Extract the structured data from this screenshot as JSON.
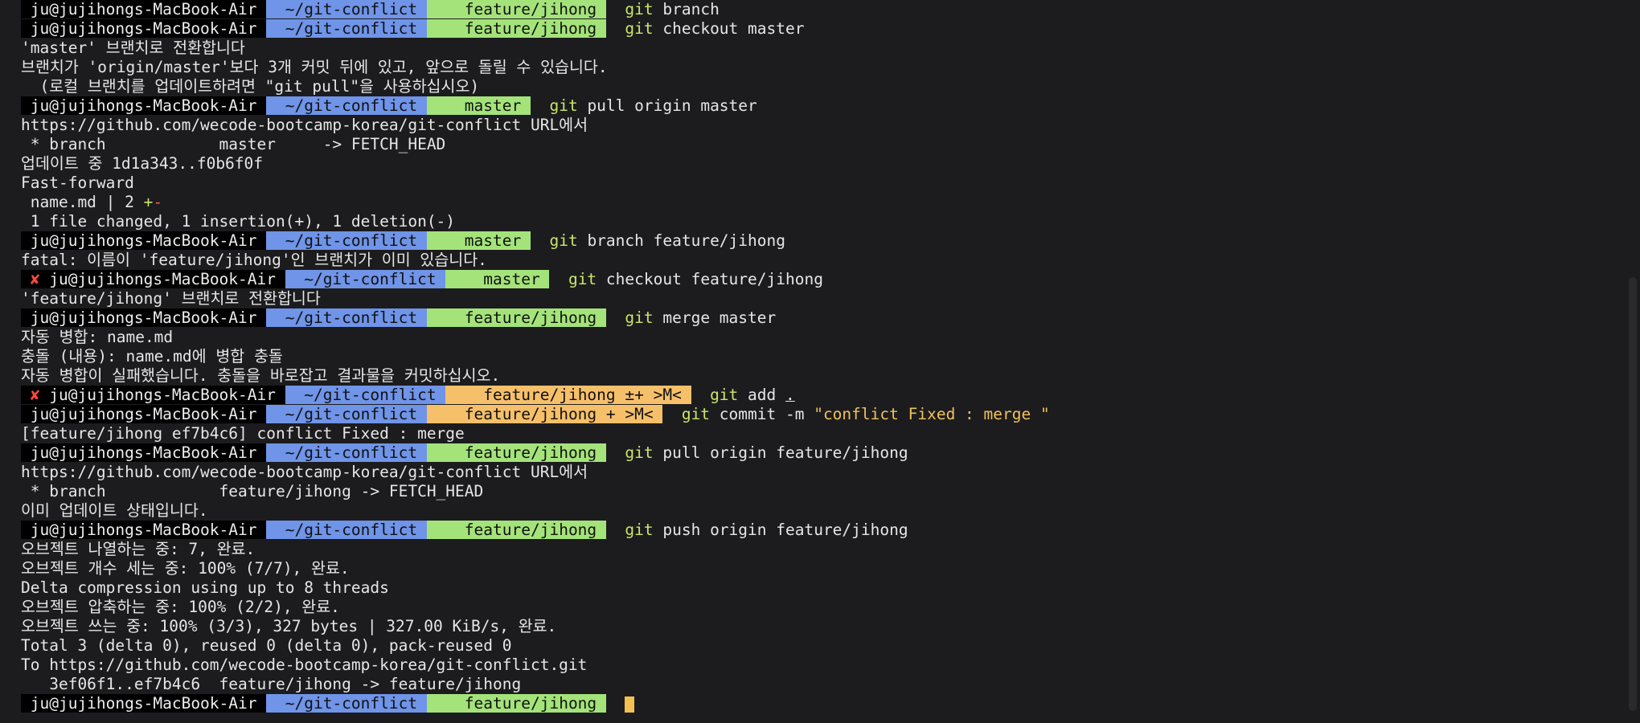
{
  "terminal": {
    "lines": [
      [
        {
          "t": " ju@jujihongs-MacBook-Air ",
          "c": "user"
        },
        {
          "t": "  ~/git-conflict ",
          "c": "dir"
        },
        {
          "t": "    feature/jihong ",
          "c": "clean"
        },
        {
          "t": "  "
        },
        {
          "t": "git",
          "c": "cmd"
        },
        {
          "t": " branch"
        }
      ],
      [
        {
          "t": " ju@jujihongs-MacBook-Air ",
          "c": "user"
        },
        {
          "t": "  ~/git-conflict ",
          "c": "dir"
        },
        {
          "t": "    feature/jihong ",
          "c": "clean"
        },
        {
          "t": "  "
        },
        {
          "t": "git",
          "c": "cmd"
        },
        {
          "t": " checkout master"
        }
      ],
      [
        {
          "t": "'master' 브랜치로 전환합니다"
        }
      ],
      [
        {
          "t": "브랜치가 'origin/master'보다 3개 커밋 뒤에 있고, 앞으로 돌릴 수 있습니다."
        }
      ],
      [
        {
          "t": "  (로컬 브랜치를 업데이트하려면 \"git pull\"을 사용하십시오)"
        }
      ],
      [
        {
          "t": " ju@jujihongs-MacBook-Air ",
          "c": "user"
        },
        {
          "t": "  ~/git-conflict ",
          "c": "dir"
        },
        {
          "t": "    master ",
          "c": "clean"
        },
        {
          "t": "  "
        },
        {
          "t": "git",
          "c": "cmd"
        },
        {
          "t": " pull origin master"
        }
      ],
      [
        {
          "t": "https://github.com/wecode-bootcamp-korea/git-conflict URL에서"
        }
      ],
      [
        {
          "t": " * branch            master     -> FETCH_HEAD"
        }
      ],
      [
        {
          "t": "업데이트 중 1d1a343..f0b6f0f"
        }
      ],
      [
        {
          "t": "Fast-forward"
        }
      ],
      [
        {
          "t": " name.md | 2 "
        },
        {
          "t": "+",
          "c": "add"
        },
        {
          "t": "-",
          "c": "del"
        }
      ],
      [
        {
          "t": " 1 file changed, 1 insertion(+), 1 deletion(-)"
        }
      ],
      [
        {
          "t": " ju@jujihongs-MacBook-Air ",
          "c": "user"
        },
        {
          "t": "  ~/git-conflict ",
          "c": "dir"
        },
        {
          "t": "    master ",
          "c": "clean"
        },
        {
          "t": "  "
        },
        {
          "t": "git",
          "c": "cmd"
        },
        {
          "t": " branch feature/jihong"
        }
      ],
      [
        {
          "t": "fatal: 이름이 'feature/jihong'인 브랜치가 이미 있습니다."
        }
      ],
      [
        {
          "t": " ✘ ",
          "c": "err"
        },
        {
          "t": "ju@jujihongs-MacBook-Air ",
          "c": "user"
        },
        {
          "t": "  ~/git-conflict ",
          "c": "dir"
        },
        {
          "t": "    master ",
          "c": "clean"
        },
        {
          "t": "  "
        },
        {
          "t": "git",
          "c": "cmd"
        },
        {
          "t": " checkout feature/jihong"
        }
      ],
      [
        {
          "t": "'feature/jihong' 브랜치로 전환합니다"
        }
      ],
      [
        {
          "t": " ju@jujihongs-MacBook-Air ",
          "c": "user"
        },
        {
          "t": "  ~/git-conflict ",
          "c": "dir"
        },
        {
          "t": "    feature/jihong ",
          "c": "clean"
        },
        {
          "t": "  "
        },
        {
          "t": "git",
          "c": "cmd"
        },
        {
          "t": " merge master"
        }
      ],
      [
        {
          "t": "자동 병합: name.md"
        }
      ],
      [
        {
          "t": "충돌 (내용): name.md에 병합 충돌"
        }
      ],
      [
        {
          "t": "자동 병합이 실패했습니다. 충돌을 바로잡고 결과물을 커밋하십시오."
        }
      ],
      [
        {
          "t": " ✘ ",
          "c": "err"
        },
        {
          "t": "ju@jujihongs-MacBook-Air ",
          "c": "user"
        },
        {
          "t": "  ~/git-conflict ",
          "c": "dir"
        },
        {
          "t": "    feature/jihong ±+ >M< ",
          "c": "dirty"
        },
        {
          "t": "  "
        },
        {
          "t": "git",
          "c": "cmd"
        },
        {
          "t": " add "
        },
        {
          "t": ".",
          "c": "under"
        }
      ],
      [
        {
          "t": " ju@jujihongs-MacBook-Air ",
          "c": "user"
        },
        {
          "t": "  ~/git-conflict ",
          "c": "dir"
        },
        {
          "t": "    feature/jihong + >M< ",
          "c": "dirty"
        },
        {
          "t": "  "
        },
        {
          "t": "git",
          "c": "cmd"
        },
        {
          "t": " commit -m "
        },
        {
          "t": "\"conflict Fixed : merge \"",
          "c": "str"
        }
      ],
      [
        {
          "t": "[feature/jihong ef7b4c6] conflict Fixed : merge"
        }
      ],
      [
        {
          "t": " ju@jujihongs-MacBook-Air ",
          "c": "user"
        },
        {
          "t": "  ~/git-conflict ",
          "c": "dir"
        },
        {
          "t": "    feature/jihong ",
          "c": "clean"
        },
        {
          "t": "  "
        },
        {
          "t": "git",
          "c": "cmd"
        },
        {
          "t": " pull origin feature/jihong"
        }
      ],
      [
        {
          "t": "https://github.com/wecode-bootcamp-korea/git-conflict URL에서"
        }
      ],
      [
        {
          "t": " * branch            feature/jihong -> FETCH_HEAD"
        }
      ],
      [
        {
          "t": "이미 업데이트 상태입니다."
        }
      ],
      [
        {
          "t": " ju@jujihongs-MacBook-Air ",
          "c": "user"
        },
        {
          "t": "  ~/git-conflict ",
          "c": "dir"
        },
        {
          "t": "    feature/jihong ",
          "c": "clean"
        },
        {
          "t": "  "
        },
        {
          "t": "git",
          "c": "cmd"
        },
        {
          "t": " push origin feature/jihong"
        }
      ],
      [
        {
          "t": "오브젝트 나열하는 중: 7, 완료."
        }
      ],
      [
        {
          "t": "오브젝트 개수 세는 중: 100% (7/7), 완료."
        }
      ],
      [
        {
          "t": "Delta compression using up to 8 threads"
        }
      ],
      [
        {
          "t": "오브젝트 압축하는 중: 100% (2/2), 완료."
        }
      ],
      [
        {
          "t": "오브젝트 쓰는 중: 100% (3/3), 327 bytes | 327.00 KiB/s, 완료."
        }
      ],
      [
        {
          "t": "Total 3 (delta 0), reused 0 (delta 0), pack-reused 0"
        }
      ],
      [
        {
          "t": "To https://github.com/wecode-bootcamp-korea/git-conflict.git"
        }
      ],
      [
        {
          "t": "   3ef06f1..ef7b4c6  feature/jihong -> feature/jihong"
        }
      ],
      [
        {
          "t": " ju@jujihongs-MacBook-Air ",
          "c": "user"
        },
        {
          "t": "  ~/git-conflict ",
          "c": "dir"
        },
        {
          "t": "    feature/jihong ",
          "c": "clean"
        },
        {
          "t": "  "
        }
      ]
    ]
  },
  "colors": {
    "background": "#1c1c1e",
    "dir_segment": "#6f94e8",
    "clean_branch_segment": "#a4e37a",
    "dirty_branch_segment": "#f6c06a",
    "command": "#c9e66a",
    "string": "#f1c15d",
    "error": "#ff4a3d",
    "cursor": "#f4c052"
  }
}
